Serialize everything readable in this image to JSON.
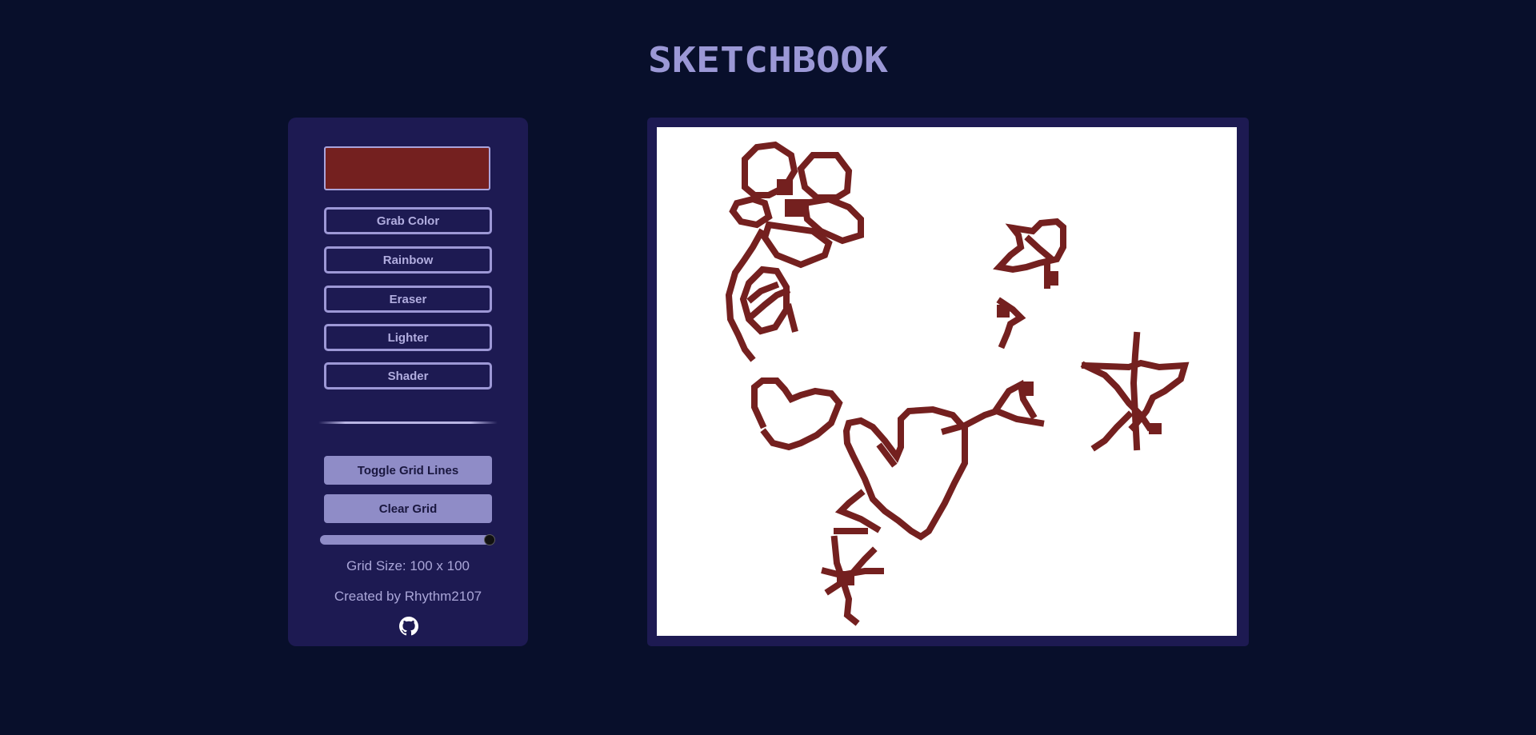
{
  "header": {
    "title": "SKETCHBOOK"
  },
  "controls": {
    "current_color": "#74201f",
    "buttons": [
      "Grab Color",
      "Rainbow",
      "Eraser",
      "Lighter",
      "Shader"
    ],
    "toggle_grid_label": "Toggle Grid Lines",
    "clear_grid_label": "Clear Grid",
    "grid_size_value": 100,
    "grid_size_text": "Grid Size: 100 x 100",
    "credit": "Created by Rhythm2107",
    "github_icon": "github-icon"
  },
  "sketch": {
    "grid": 100,
    "ink_color": "#74201f",
    "background": "#ffffff"
  },
  "colors": {
    "page_bg": "#080f2b",
    "panel_bg": "#1d1a52",
    "title_color": "#9b98d6",
    "accent": "#8f8cc7"
  }
}
